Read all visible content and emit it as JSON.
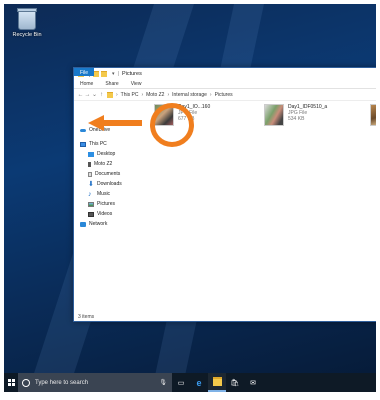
{
  "desktop": {
    "recycle_bin_label": "Recycle Bin"
  },
  "window": {
    "title": "Pictures",
    "ribbon_tabs": [
      "File",
      "Home",
      "Share",
      "View"
    ],
    "address": {
      "crumbs": [
        "This PC",
        "Moto Z2",
        "Internal storage",
        "Pictures"
      ]
    },
    "nav_pane": [
      {
        "label": "OneDrive",
        "icon": "cloud-icon",
        "indent": false
      },
      {
        "label": "This PC",
        "icon": "computer-icon",
        "indent": false
      },
      {
        "label": "Desktop",
        "icon": "desktop-folder-icon",
        "indent": true
      },
      {
        "label": "Moto Z2",
        "icon": "phone-icon",
        "indent": true
      },
      {
        "label": "Documents",
        "icon": "documents-icon",
        "indent": true
      },
      {
        "label": "Downloads",
        "icon": "downloads-icon",
        "indent": true
      },
      {
        "label": "Music",
        "icon": "music-icon",
        "indent": true
      },
      {
        "label": "Pictures",
        "icon": "pictures-icon",
        "indent": true
      },
      {
        "label": "Videos",
        "icon": "videos-icon",
        "indent": true
      },
      {
        "label": "Network",
        "icon": "network-icon",
        "indent": false
      }
    ],
    "files": [
      {
        "name": "Day1_IO...160",
        "type": "JPG File",
        "size": "677 KB"
      },
      {
        "name": "Day1_IDF0510_a",
        "type": "JPG File",
        "size": "534 KB"
      }
    ],
    "status": "3 items"
  },
  "taskbar": {
    "search_placeholder": "Type here to search",
    "apps": [
      "task-view-icon",
      "edge-icon",
      "file-explorer-icon",
      "store-icon",
      "mail-icon"
    ]
  },
  "colors": {
    "annotation": "#f07e1e",
    "ribbon_file_tab": "#1979ca",
    "taskbar": "#0e1a26"
  }
}
